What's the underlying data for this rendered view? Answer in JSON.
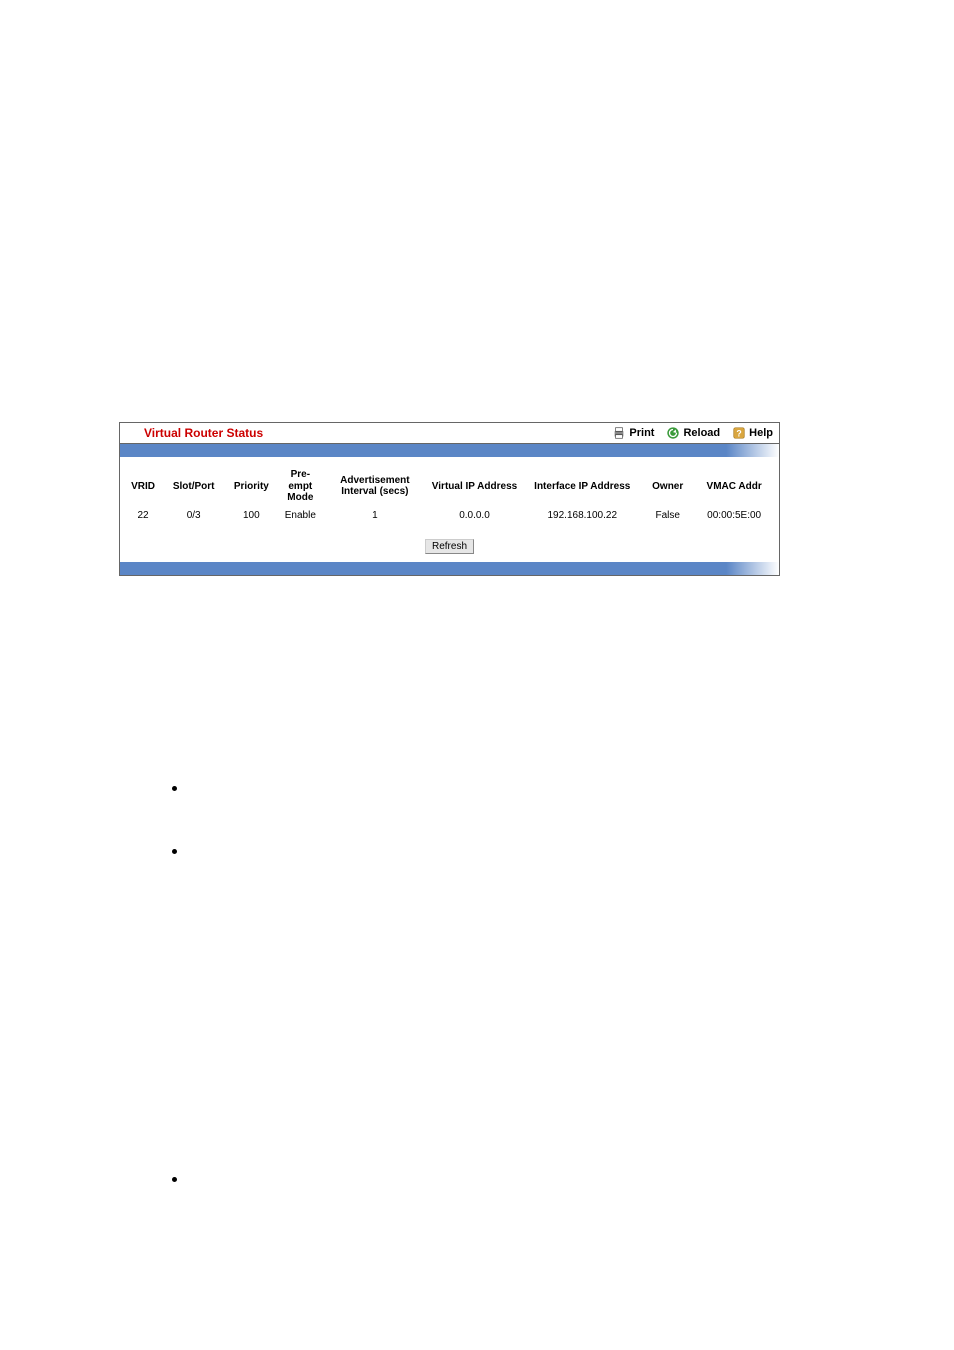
{
  "panel": {
    "title": "Virtual Router Status",
    "actions": {
      "print": "Print",
      "reload": "Reload",
      "help": "Help"
    }
  },
  "table": {
    "headers": {
      "vrid": "VRID",
      "slot_port": "Slot/Port",
      "priority": "Priority",
      "preempt": "Pre- empt Mode",
      "adv_interval": "Advertisement Interval (secs)",
      "vip": "Virtual IP Address",
      "ifip": "Interface IP Address",
      "owner": "Owner",
      "vmac": "VMAC Addr"
    },
    "rows": [
      {
        "vrid": "22",
        "slot_port": "0/3",
        "priority": "100",
        "preempt": "Enable",
        "adv_interval": "1",
        "vip": "0.0.0.0",
        "ifip": "192.168.100.22",
        "owner": "False",
        "vmac": "00:00:5E:00"
      }
    ]
  },
  "buttons": {
    "refresh": "Refresh"
  }
}
